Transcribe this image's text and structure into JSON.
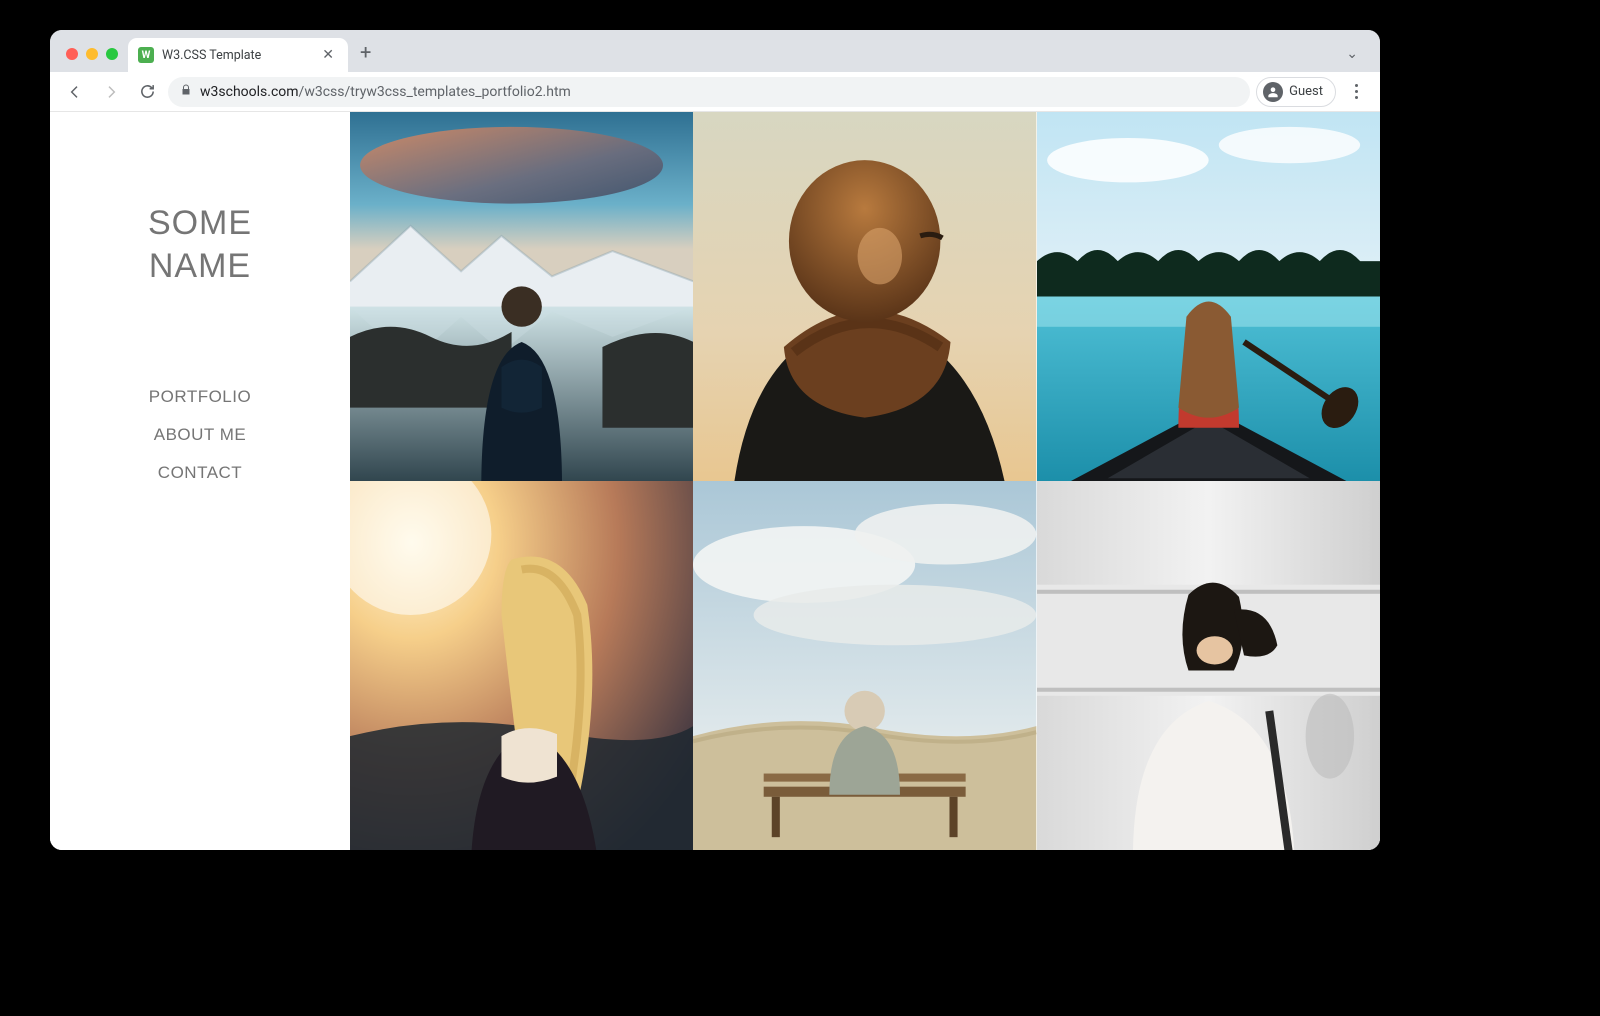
{
  "browser": {
    "tab_title": "W3.CSS Template",
    "favicon_letter": "W",
    "url_host": "w3schools.com",
    "url_path": "/w3css/tryw3css_templates_portfolio2.htm",
    "guest_label": "Guest"
  },
  "site": {
    "brand_line1": "SOME",
    "brand_line2": "NAME",
    "nav": [
      {
        "label": "PORTFOLIO"
      },
      {
        "label": "ABOUT ME"
      },
      {
        "label": "CONTACT"
      }
    ],
    "tiles": [
      {
        "name": "man-lake-mountains"
      },
      {
        "name": "woman-scarf-sunset"
      },
      {
        "name": "woman-canoe-lake"
      },
      {
        "name": "girl-sunflare"
      },
      {
        "name": "person-bench-sky"
      },
      {
        "name": "woman-train-station"
      }
    ]
  }
}
